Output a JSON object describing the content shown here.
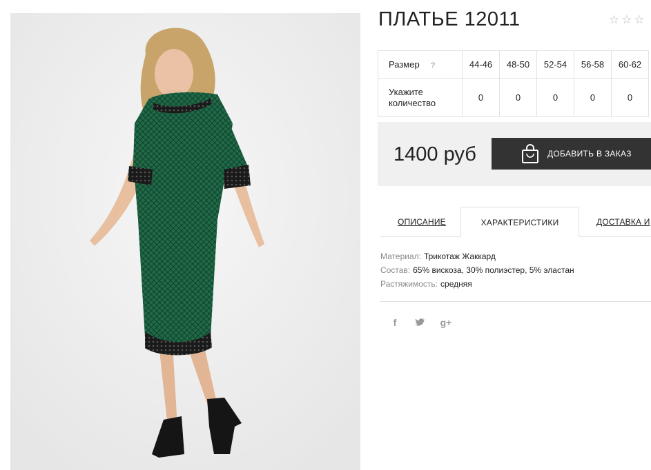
{
  "product": {
    "title": "ПЛАТЬЕ 12011",
    "rating_stars": 5,
    "photo_alt_colors": {
      "dress": "#1f6b48",
      "lace": "#1a1a1a",
      "background": "#ececec"
    }
  },
  "size_table": {
    "size_label": "Размер",
    "help_symbol": "?",
    "qty_label": "Укажите количество",
    "sizes": [
      "44-46",
      "48-50",
      "52-54",
      "56-58",
      "60-62"
    ],
    "quantities": [
      "0",
      "0",
      "0",
      "0",
      "0"
    ]
  },
  "buy": {
    "price": "1400 руб",
    "add_label": "ДОБАВИТЬ В ЗАКАЗ"
  },
  "tabs": [
    {
      "label": "ОПИСАНИЕ",
      "active": false
    },
    {
      "label": "ХАРАКТЕРИСТИКИ",
      "active": true
    },
    {
      "label": "ДОСТАВКА И",
      "active": false
    }
  ],
  "specs": [
    {
      "key": "Материал:",
      "value": "Трикотаж Жаккард"
    },
    {
      "key": "Состав:",
      "value": "65% вискоза, 30% полиэстер, 5% эластан"
    },
    {
      "key": "Растяжимость:",
      "value": "средняя"
    }
  ],
  "social": [
    {
      "icon": "facebook-icon",
      "glyph": "f"
    },
    {
      "icon": "twitter-icon",
      "glyph": "t"
    },
    {
      "icon": "google-plus-icon",
      "glyph": "g+"
    }
  ]
}
